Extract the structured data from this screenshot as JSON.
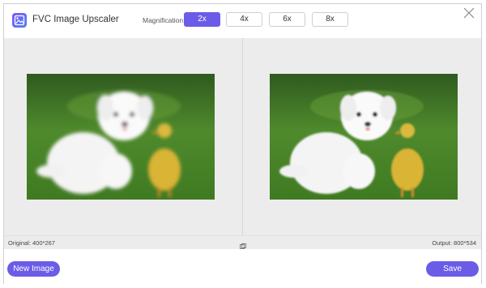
{
  "app": {
    "title": "FVC Image Upscaler"
  },
  "magnification": {
    "label": "Magnification:",
    "options": [
      "2x",
      "4x",
      "6x",
      "8x"
    ],
    "selected": "2x"
  },
  "info": {
    "original": "Original: 400*267",
    "output": "Output: 800*534"
  },
  "footer": {
    "new_image_label": "New Image",
    "save_label": "Save"
  },
  "colors": {
    "accent": "#6b5ce7",
    "workarea": "#ececec"
  },
  "icons": {
    "logo": "image-upscaler-logo-icon",
    "close": "close-icon",
    "compare": "compare-icon"
  }
}
